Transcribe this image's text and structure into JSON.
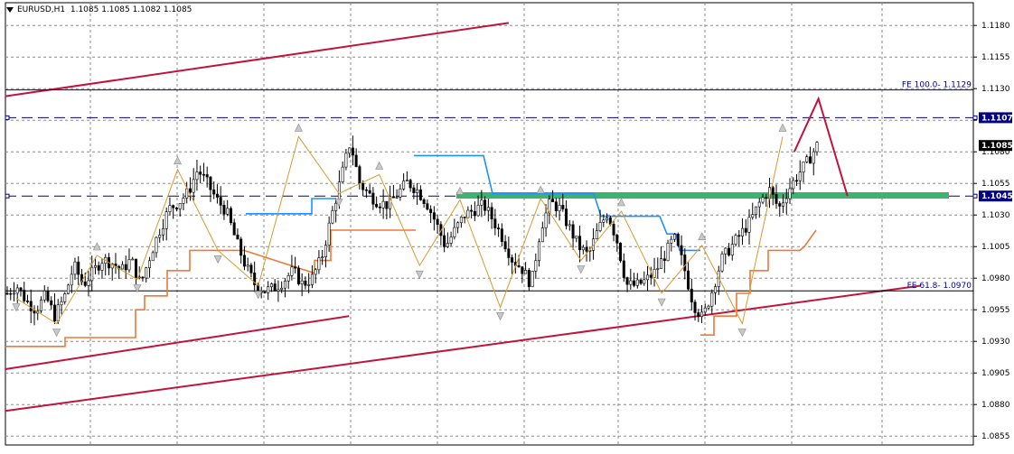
{
  "header": {
    "symbol": "EURUSD,H1",
    "ohlc": "1.1085 1.1085 1.1082 1.1085"
  },
  "colors": {
    "grid": "#8a8a8a",
    "channel": "#c0143c",
    "support_resistance": "#000080",
    "zone": "#3cb371",
    "trail_orange": "#f07838",
    "trail_blue": "#1e90ff",
    "zigzag": "#d89a30",
    "candle": "#000000"
  },
  "chart_data": {
    "type": "candlestick",
    "symbol": "EURUSD",
    "timeframe": "H1",
    "ylim": [
      1.0848,
      1.1198
    ],
    "y_ticks": [
      "1.1180",
      "1.1155",
      "1.1130",
      "1.1105",
      "1.1080",
      "1.1055",
      "1.1030",
      "1.1005",
      "1.0980",
      "1.0955",
      "1.0930",
      "1.0905",
      "1.0880",
      "1.0855"
    ],
    "current_price": "1.1085",
    "levels": [
      {
        "price": 1.1129,
        "label": "FE 100.0- 1.1129",
        "style": "solid"
      },
      {
        "price": 1.097,
        "label": "FE 61.8- 1.0970",
        "style": "solid"
      },
      {
        "price": 1.1107,
        "label": "1.1107",
        "style": "dashed"
      },
      {
        "price": 1.1045,
        "label": "1.1045",
        "style": "dashed"
      }
    ],
    "close_path": [
      1.0968,
      1.0974,
      1.0962,
      1.0955,
      1.0966,
      1.095,
      1.0965,
      1.099,
      1.0975,
      1.0985,
      1.0995,
      1.0992,
      1.0986,
      1.0995,
      1.0975,
      1.0998,
      1.1018,
      1.1035,
      1.104,
      1.1048,
      1.1066,
      1.1055,
      1.1042,
      1.1033,
      1.101,
      1.099,
      1.0975,
      1.097,
      1.0972,
      1.0978,
      1.0986,
      1.0975,
      1.098,
      1.0996,
      1.1028,
      1.1058,
      1.1088,
      1.1055,
      1.1046,
      1.104,
      1.1038,
      1.1047,
      1.1056,
      1.105,
      1.104,
      1.1024,
      1.1005,
      1.1018,
      1.103,
      1.1034,
      1.1038,
      1.1026,
      1.1012,
      1.0995,
      1.0988,
      1.0975,
      1.102,
      1.104,
      1.1035,
      1.102,
      1.1005,
      1.0998,
      1.1018,
      1.1032,
      1.101,
      1.0975,
      1.0974,
      1.0978,
      1.0985,
      1.0998,
      1.1012,
      1.099,
      1.096,
      1.0948,
      1.097,
      1.0995,
      1.1005,
      1.1015,
      1.1025,
      1.104,
      1.105,
      1.1035,
      1.105,
      1.1062,
      1.1072,
      1.1085
    ],
    "zigzag": [
      1.0964,
      1.0944,
      1.0998,
      1.0979,
      1.1066,
      1.1002,
      1.0974,
      1.1092,
      1.1047,
      1.1062,
      1.099,
      1.1042,
      1.0957,
      1.1043,
      1.0994,
      1.1033,
      1.0968,
      1.1006,
      1.0944,
      1.1092
    ],
    "channel_lines": [
      {
        "from": [
          0,
          1.1124
        ],
        "to": [
          0.52,
          1.1182
        ]
      },
      {
        "from": [
          0,
          1.0908
        ],
        "to": [
          0.355,
          1.095
        ]
      },
      {
        "from": [
          0,
          1.0875
        ],
        "to": [
          0.945,
          1.0974
        ]
      }
    ],
    "projection": [
      [
        0.815,
        1.108
      ],
      [
        0.84,
        1.1122
      ],
      [
        0.87,
        1.1045
      ]
    ],
    "resistance_zone": [
      1.1043,
      1.1048
    ],
    "grid": "on",
    "legend": "none"
  }
}
